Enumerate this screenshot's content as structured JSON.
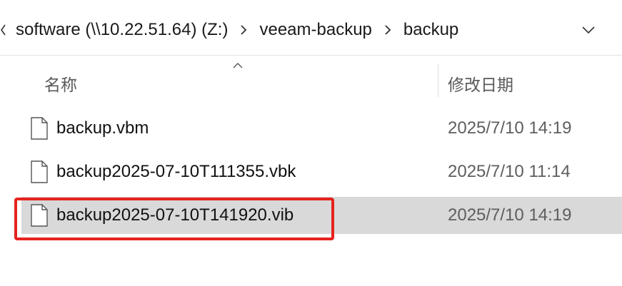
{
  "address_bar": {
    "crumbs": [
      "software (\\\\10.22.51.64) (Z:)",
      "veeam-backup",
      "backup"
    ]
  },
  "columns": {
    "name": "名称",
    "date_modified": "修改日期"
  },
  "files": [
    {
      "name": "backup.vbm",
      "date": "2025/7/10 14:19",
      "selected": false
    },
    {
      "name": "backup2025-07-10T111355.vbk",
      "date": "2025/7/10 11:14",
      "selected": false
    },
    {
      "name": "backup2025-07-10T141920.vib",
      "date": "2025/7/10 14:19",
      "selected": true
    }
  ],
  "highlight_color": "#e5231f",
  "selected_row_color": "#d9d9d9"
}
